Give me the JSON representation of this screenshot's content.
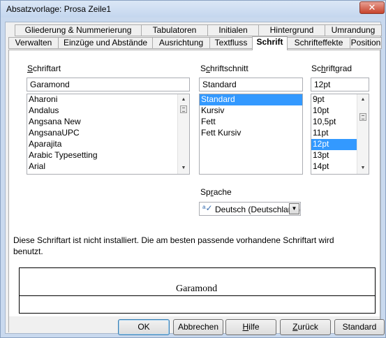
{
  "window": {
    "title": "Absatzvorlage: Prosa Zeile1",
    "close_label": "✕"
  },
  "tabs_row1": [
    "Gliederung & Nummerierung",
    "Tabulatoren",
    "Initialen",
    "Hintergrund",
    "Umrandung"
  ],
  "tabs_row2": [
    "Verwalten",
    "Einzüge und Abstände",
    "Ausrichtung",
    "Textfluss",
    "Schrift",
    "Schrifteffekte",
    "Position"
  ],
  "active_tab": "Schrift",
  "font": {
    "label_first": "S",
    "label_rest": "chriftart",
    "value": "Garamond",
    "items": [
      "Aharoni",
      "Andalus",
      "Angsana New",
      "AngsanaUPC",
      "Aparajita",
      "Arabic Typesetting",
      "Arial"
    ]
  },
  "style": {
    "label_pre": "S",
    "label_ul": "c",
    "label_post": "hriftschnitt",
    "value": "Standard",
    "items": [
      "Standard",
      "Kursiv",
      "Fett",
      "Fett Kursiv"
    ],
    "selected": "Standard"
  },
  "size": {
    "label_pre": "Sc",
    "label_ul": "h",
    "label_post": "riftgrad",
    "value": "12pt",
    "items": [
      "9pt",
      "10pt",
      "10,5pt",
      "11pt",
      "12pt",
      "13pt",
      "14pt"
    ],
    "selected": "12pt"
  },
  "language": {
    "label_pre": "Sp",
    "label_ul": "r",
    "label_post": "ache",
    "value": "Deutsch (Deutschland)",
    "icon": "spellcheck-icon"
  },
  "notice": "Diese Schriftart ist nicht installiert. Die am besten passende vorhandene Schriftart wird benutzt.",
  "preview_text": "Garamond",
  "buttons": {
    "ok": "OK",
    "cancel": "Abbrechen",
    "help_ul": "H",
    "help_rest": "ilfe",
    "back_ul": "Z",
    "back_rest": "urück",
    "default": "Standard"
  },
  "colors": {
    "selection": "#3399ff",
    "titlebar": "#c4d6ee",
    "close": "#c7432b"
  }
}
